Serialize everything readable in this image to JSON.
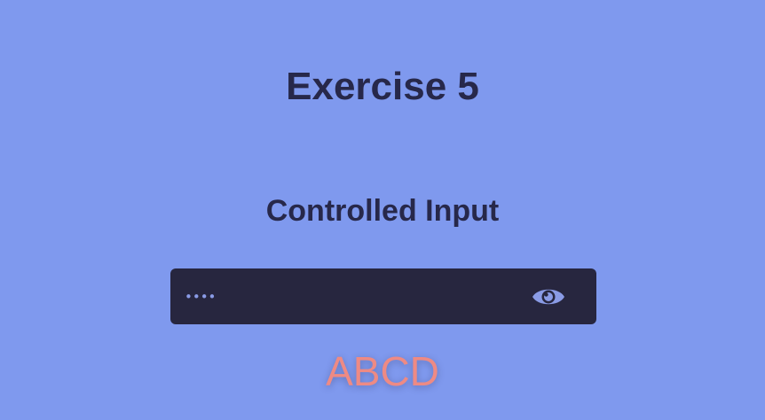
{
  "header": {
    "title": "Exercise 5",
    "subtitle": "Controlled Input"
  },
  "password_field": {
    "masked_value": "••••",
    "visibility_icon": "eye-icon"
  },
  "echo_text": "ABCD",
  "colors": {
    "background": "#7f99ee",
    "input_background": "#27263f",
    "heading": "#27284a",
    "icon": "#8a9be6",
    "echo": "#ee8a84"
  }
}
